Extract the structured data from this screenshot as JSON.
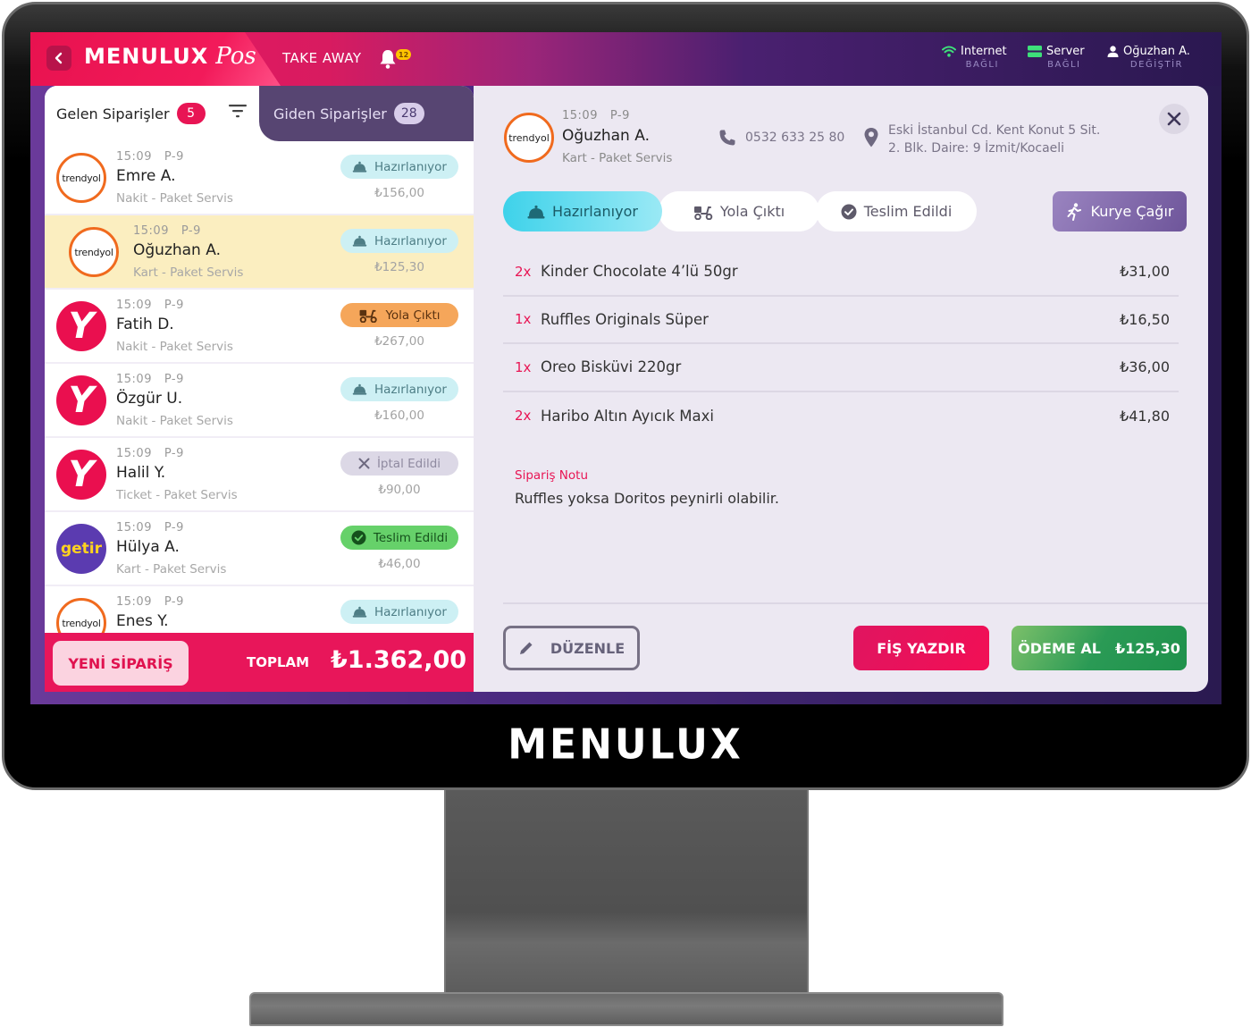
{
  "device": {
    "brand": "MENULUX"
  },
  "topbar": {
    "logo_main": "MENULUX",
    "logo_script": "Pos",
    "mode": "TAKE AWAY",
    "notification_count": "12",
    "status": [
      {
        "label": "Internet",
        "sub": "BAĞLI",
        "icon": "wifi-icon",
        "color": "#3ee07a"
      },
      {
        "label": "Server",
        "sub": "BAĞLI",
        "icon": "server-icon",
        "color": "#3ee07a"
      },
      {
        "label": "Oğuzhan A.",
        "sub": "DEĞİŞTİR",
        "icon": "user-icon",
        "color": "#ffffff"
      }
    ]
  },
  "tabs": {
    "incoming": {
      "label": "Gelen Siparişler",
      "count": "5"
    },
    "outgoing": {
      "label": "Giden Siparişler",
      "count": "28"
    }
  },
  "orders": [
    {
      "time": "15:09",
      "ref": "P-9",
      "customer": "Emre A.",
      "payment": "Nakit - Paket Servis",
      "platform": "trendyol",
      "status": "Hazırlanıyor",
      "status_type": "preparing",
      "amount": "₺156,00",
      "selected": false
    },
    {
      "time": "15:09",
      "ref": "P-9",
      "customer": "Oğuzhan A.",
      "payment": "Kart - Paket Servis",
      "platform": "trendyol",
      "status": "Hazırlanıyor",
      "status_type": "preparing",
      "amount": "₺125,30",
      "selected": true
    },
    {
      "time": "15:09",
      "ref": "P-9",
      "customer": "Fatih D.",
      "payment": "Nakit - Paket Servis",
      "platform": "yemeksepeti",
      "status": "Yola Çıktı",
      "status_type": "onway",
      "amount": "₺267,00",
      "selected": false
    },
    {
      "time": "15:09",
      "ref": "P-9",
      "customer": "Özgür U.",
      "payment": "Nakit - Paket Servis",
      "platform": "yemeksepeti",
      "status": "Hazırlanıyor",
      "status_type": "preparing",
      "amount": "₺160,00",
      "selected": false
    },
    {
      "time": "15:09",
      "ref": "P-9",
      "customer": "Halil Y.",
      "payment": "Ticket - Paket Servis",
      "platform": "yemeksepeti",
      "status": "İptal Edildi",
      "status_type": "cancelled",
      "amount": "₺90,00",
      "selected": false
    },
    {
      "time": "15:09",
      "ref": "P-9",
      "customer": "Hülya A.",
      "payment": "Kart - Paket Servis",
      "platform": "getir",
      "status": "Teslim Edildi",
      "status_type": "delivered",
      "amount": "₺46,00",
      "selected": false
    },
    {
      "time": "15:09",
      "ref": "P-9",
      "customer": "Enes Y.",
      "payment": "",
      "platform": "trendyol",
      "status": "Hazırlanıyor",
      "status_type": "preparing",
      "amount": "",
      "selected": false
    }
  ],
  "platform_labels": {
    "trendyol": "trendyol",
    "yemeksepeti": "Y",
    "getir": "getir"
  },
  "left_footer": {
    "new_order_label": "YENİ SİPARİŞ",
    "total_label": "TOPLAM",
    "total_value": "₺1.362,00"
  },
  "detail": {
    "platform": "trendyol",
    "time": "15:09",
    "ref": "P-9",
    "customer": "Oğuzhan A.",
    "payment": "Kart - Paket Servis",
    "phone": "0532 633 25 80",
    "address_line1": "Eski İstanbul Cd. Kent Konut 5 Sit.",
    "address_line2": "2. Blk. Daire: 9 İzmit/Kocaeli",
    "steps": [
      {
        "label": "Hazırlanıyor",
        "active": true
      },
      {
        "label": "Yola Çıktı",
        "active": false
      },
      {
        "label": "Teslim Edildi",
        "active": false
      }
    ],
    "courier_label": "Kurye Çağır",
    "items": [
      {
        "qty": "2x",
        "name": "Kinder Chocolate 4’lü 50gr",
        "price": "₺31,00"
      },
      {
        "qty": "1x",
        "name": "Ruffles Originals Süper",
        "price": "₺16,50"
      },
      {
        "qty": "1x",
        "name": "Oreo Bisküvi 220gr",
        "price": "₺36,00"
      },
      {
        "qty": "2x",
        "name": "Haribo Altın Ayıcık Maxi",
        "price": "₺41,80"
      }
    ],
    "note_label": "Sipariş Notu",
    "note_text": "Ruffles yoksa Doritos peynirli olabilir.",
    "edit_label": "DÜZENLE",
    "print_label": "FİŞ YAZDIR",
    "pay_label": "ÖDEME AL",
    "pay_amount": "₺125,30"
  },
  "colors": {
    "accent_pink": "#e81554",
    "outgoing_tab": "#574572",
    "preparing": "#cdf0f4",
    "onway": "#f5a65a",
    "cancelled": "#dcd8e6",
    "delivered": "#66d16a",
    "pay_green": "#2a9a55"
  }
}
